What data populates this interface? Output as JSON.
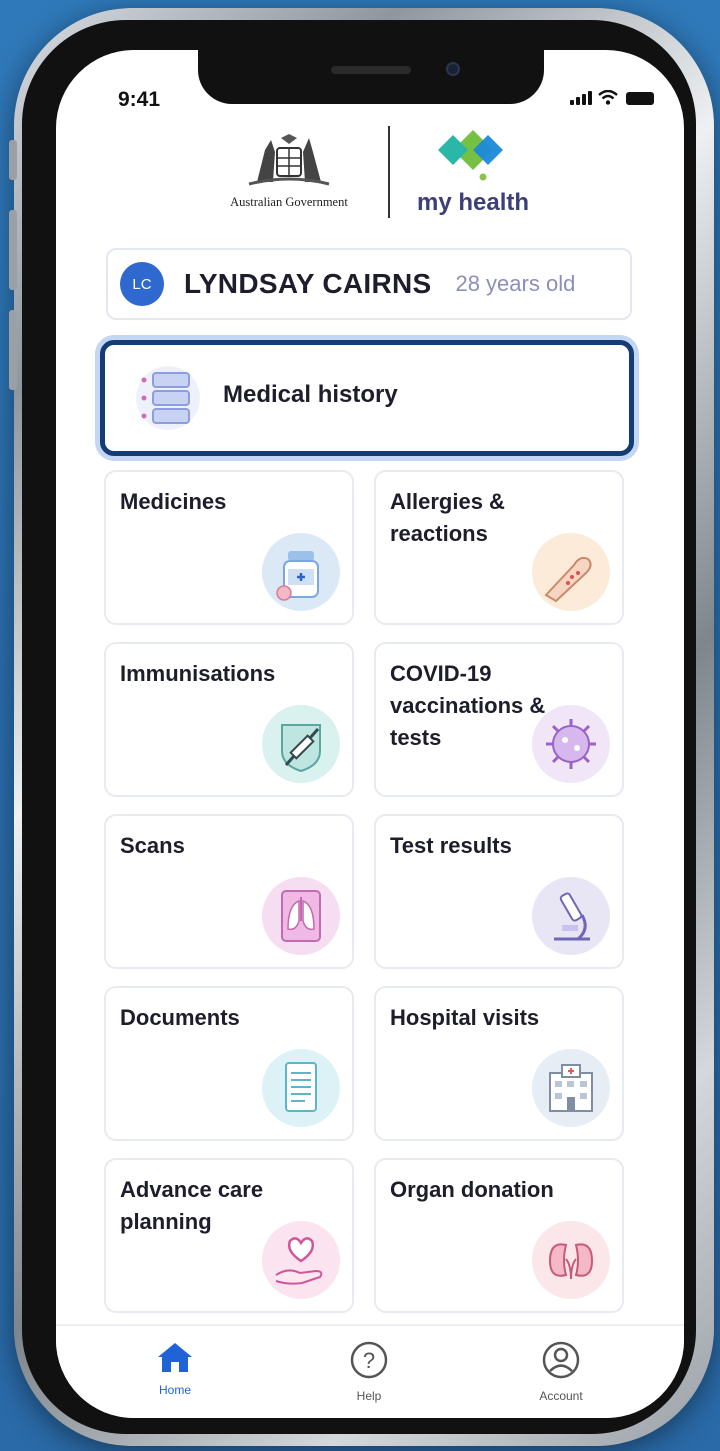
{
  "status_bar": {
    "time": "9:41"
  },
  "header": {
    "gov_logo_text": "Australian Government",
    "app_logo_text": "my health"
  },
  "profile": {
    "initials": "LC",
    "name": "LYNDSAY CAIRNS",
    "age": "28 years old"
  },
  "featured": {
    "label": "Medical history"
  },
  "tiles": [
    {
      "label": "Medicines",
      "icon": "medicine-bottle-icon",
      "bg": "#dbe9f7"
    },
    {
      "label": "Allergies & reactions",
      "icon": "allergic-arm-icon",
      "bg": "#fdebd9"
    },
    {
      "label": "Immunisations",
      "icon": "syringe-icon",
      "bg": "#d9f1ef"
    },
    {
      "label": "COVID-19 vaccinations & tests",
      "icon": "virus-icon",
      "bg": "#f0e6f7"
    },
    {
      "label": "Scans",
      "icon": "xray-lungs-icon",
      "bg": "#f6def2"
    },
    {
      "label": "Test results",
      "icon": "microscope-icon",
      "bg": "#e8e5f5"
    },
    {
      "label": "Documents",
      "icon": "document-icon",
      "bg": "#ddf2f6"
    },
    {
      "label": "Hospital visits",
      "icon": "hospital-icon",
      "bg": "#e6edf5"
    },
    {
      "label": "Advance care planning",
      "icon": "hand-heart-icon",
      "bg": "#fbe4ef"
    },
    {
      "label": "Organ donation",
      "icon": "kidneys-icon",
      "bg": "#fbe6ea"
    }
  ],
  "nav": {
    "home": "Home",
    "help": "Help",
    "account": "Account"
  },
  "colors": {
    "active_nav": "#1f63d6",
    "inactive_nav": "#555555",
    "featured_border": "#143c75"
  }
}
